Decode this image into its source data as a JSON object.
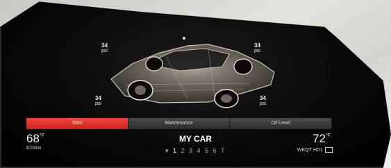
{
  "tires": {
    "front_left": {
      "value": "34",
      "unit": "psi"
    },
    "rear_left": {
      "value": "34",
      "unit": "psi"
    },
    "front_right": {
      "value": "34",
      "unit": "psi"
    },
    "rear_right": {
      "value": "34",
      "unit": "psi"
    }
  },
  "tabs": [
    {
      "label": "Tires",
      "active": true
    },
    {
      "label": "Maintenance",
      "active": false
    },
    {
      "label": "Oil Level",
      "active": false
    }
  ],
  "outside_temp": {
    "value": "68",
    "unit": "°F"
  },
  "clock": "6:04",
  "clock_suffix": "PM",
  "title": "MY CAR",
  "gears": {
    "arrow": "▾",
    "selected": "1",
    "others": "2 3 4 5 6 7"
  },
  "set_temp": {
    "value": "72",
    "unit": "°F"
  },
  "radio": "WKQT HD1",
  "colors": {
    "active_tab": "#e0342b",
    "background": "#000000"
  }
}
